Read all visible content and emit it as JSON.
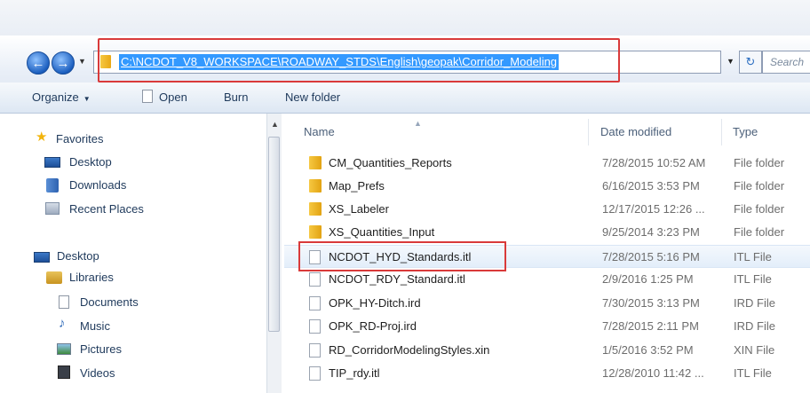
{
  "address_bar": {
    "path": "C:\\NCDOT_V8_WORKSPACE\\ROADWAY_STDS\\English\\geopak\\Corridor_Modeling",
    "search_placeholder": "Search"
  },
  "toolbar": {
    "organize": "Organize",
    "open": "Open",
    "burn": "Burn",
    "new_folder": "New folder"
  },
  "nav": {
    "favorites": "Favorites",
    "desktop": "Desktop",
    "downloads": "Downloads",
    "recent_places": "Recent Places",
    "desktop2": "Desktop",
    "libraries": "Libraries",
    "documents": "Documents",
    "music": "Music",
    "pictures": "Pictures",
    "videos": "Videos"
  },
  "columns": {
    "name": "Name",
    "date_modified": "Date modified",
    "type": "Type"
  },
  "files": [
    {
      "name": "CM_Quantities_Reports",
      "date": "7/28/2015 10:52 AM",
      "type": "File folder",
      "kind": "folder"
    },
    {
      "name": "Map_Prefs",
      "date": "6/16/2015 3:53 PM",
      "type": "File folder",
      "kind": "folder"
    },
    {
      "name": "XS_Labeler",
      "date": "12/17/2015 12:26 ...",
      "type": "File folder",
      "kind": "folder"
    },
    {
      "name": "XS_Quantities_Input",
      "date": "9/25/2014 3:23 PM",
      "type": "File folder",
      "kind": "folder"
    },
    {
      "name": "NCDOT_HYD_Standards.itl",
      "date": "7/28/2015 5:16 PM",
      "type": "ITL File",
      "kind": "file"
    },
    {
      "name": "NCDOT_RDY_Standard.itl",
      "date": "2/9/2016 1:25 PM",
      "type": "ITL File",
      "kind": "file"
    },
    {
      "name": "OPK_HY-Ditch.ird",
      "date": "7/30/2015 3:13 PM",
      "type": "IRD File",
      "kind": "file"
    },
    {
      "name": "OPK_RD-Proj.ird",
      "date": "7/28/2015 2:11 PM",
      "type": "IRD File",
      "kind": "file"
    },
    {
      "name": "RD_CorridorModelingStyles.xin",
      "date": "1/5/2016 3:52 PM",
      "type": "XIN File",
      "kind": "file"
    },
    {
      "name": "TIP_rdy.itl",
      "date": "12/28/2010 11:42 ...",
      "type": "ITL File",
      "kind": "file"
    }
  ]
}
